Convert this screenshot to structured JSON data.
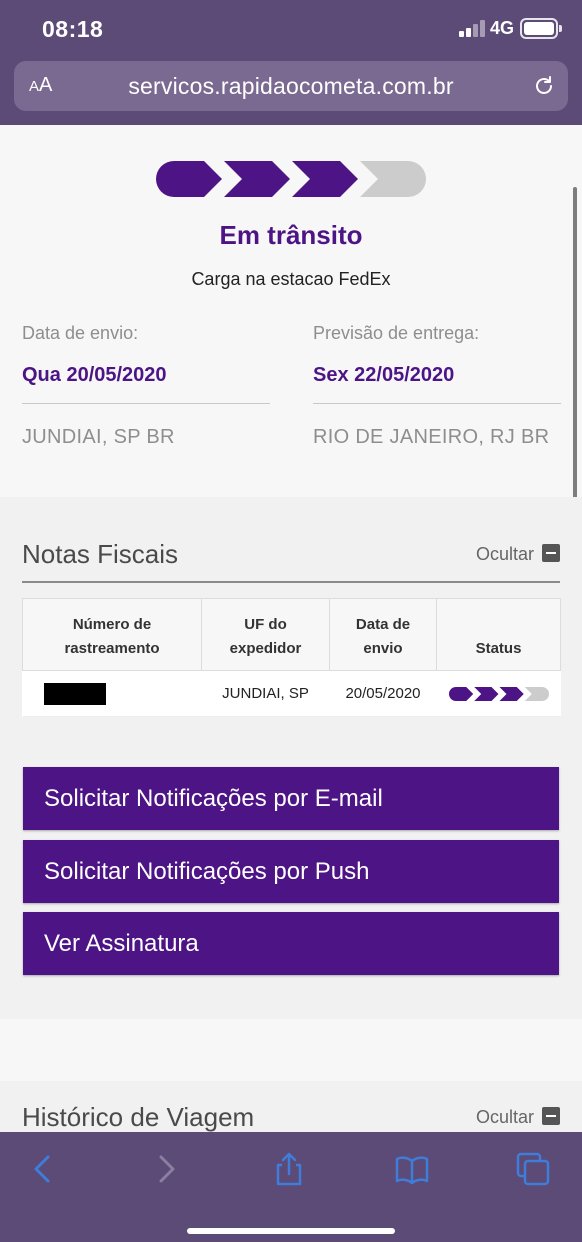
{
  "statusbar": {
    "time": "08:18",
    "network": "4G"
  },
  "browser": {
    "aa_label": "AA",
    "url": "servicos.rapidaocometa.com.br"
  },
  "shipment": {
    "progress_steps_completed": 3,
    "progress_steps_total": 4,
    "status_title": "Em trânsito",
    "status_detail": "Carga na estacao FedEx",
    "send_label": "Data de envio:",
    "send_date": "Qua 20/05/2020",
    "send_city": "JUNDIAI, SP BR",
    "delivery_label": "Previsão de entrega:",
    "delivery_date": "Sex 22/05/2020",
    "delivery_city": "RIO DE JANEIRO, RJ BR"
  },
  "notas": {
    "title": "Notas Fiscais",
    "hide_label": "Ocultar",
    "columns": [
      "Número de rastreamento",
      "UF do expedidor",
      "Data de envio",
      "Status"
    ],
    "rows": [
      {
        "uf": "JUNDIAI, SP",
        "date": "20/05/2020",
        "status_steps": 3,
        "status_total": 4
      }
    ]
  },
  "actions": {
    "email": "Solicitar Notificações por E-mail",
    "push": "Solicitar Notificações por Push",
    "signature": "Ver Assinatura"
  },
  "historico": {
    "title": "Histórico de Viagem",
    "hide_label": "Ocultar"
  },
  "colors": {
    "brand_purple": "#4d1486",
    "chrome": "#5c4a77",
    "step_inactive": "#cccccc",
    "toolbar_icon": "#3f7ddb"
  },
  "toolbar_icons": [
    "back-icon",
    "forward-icon",
    "share-icon",
    "bookmarks-icon",
    "tabs-icon"
  ]
}
